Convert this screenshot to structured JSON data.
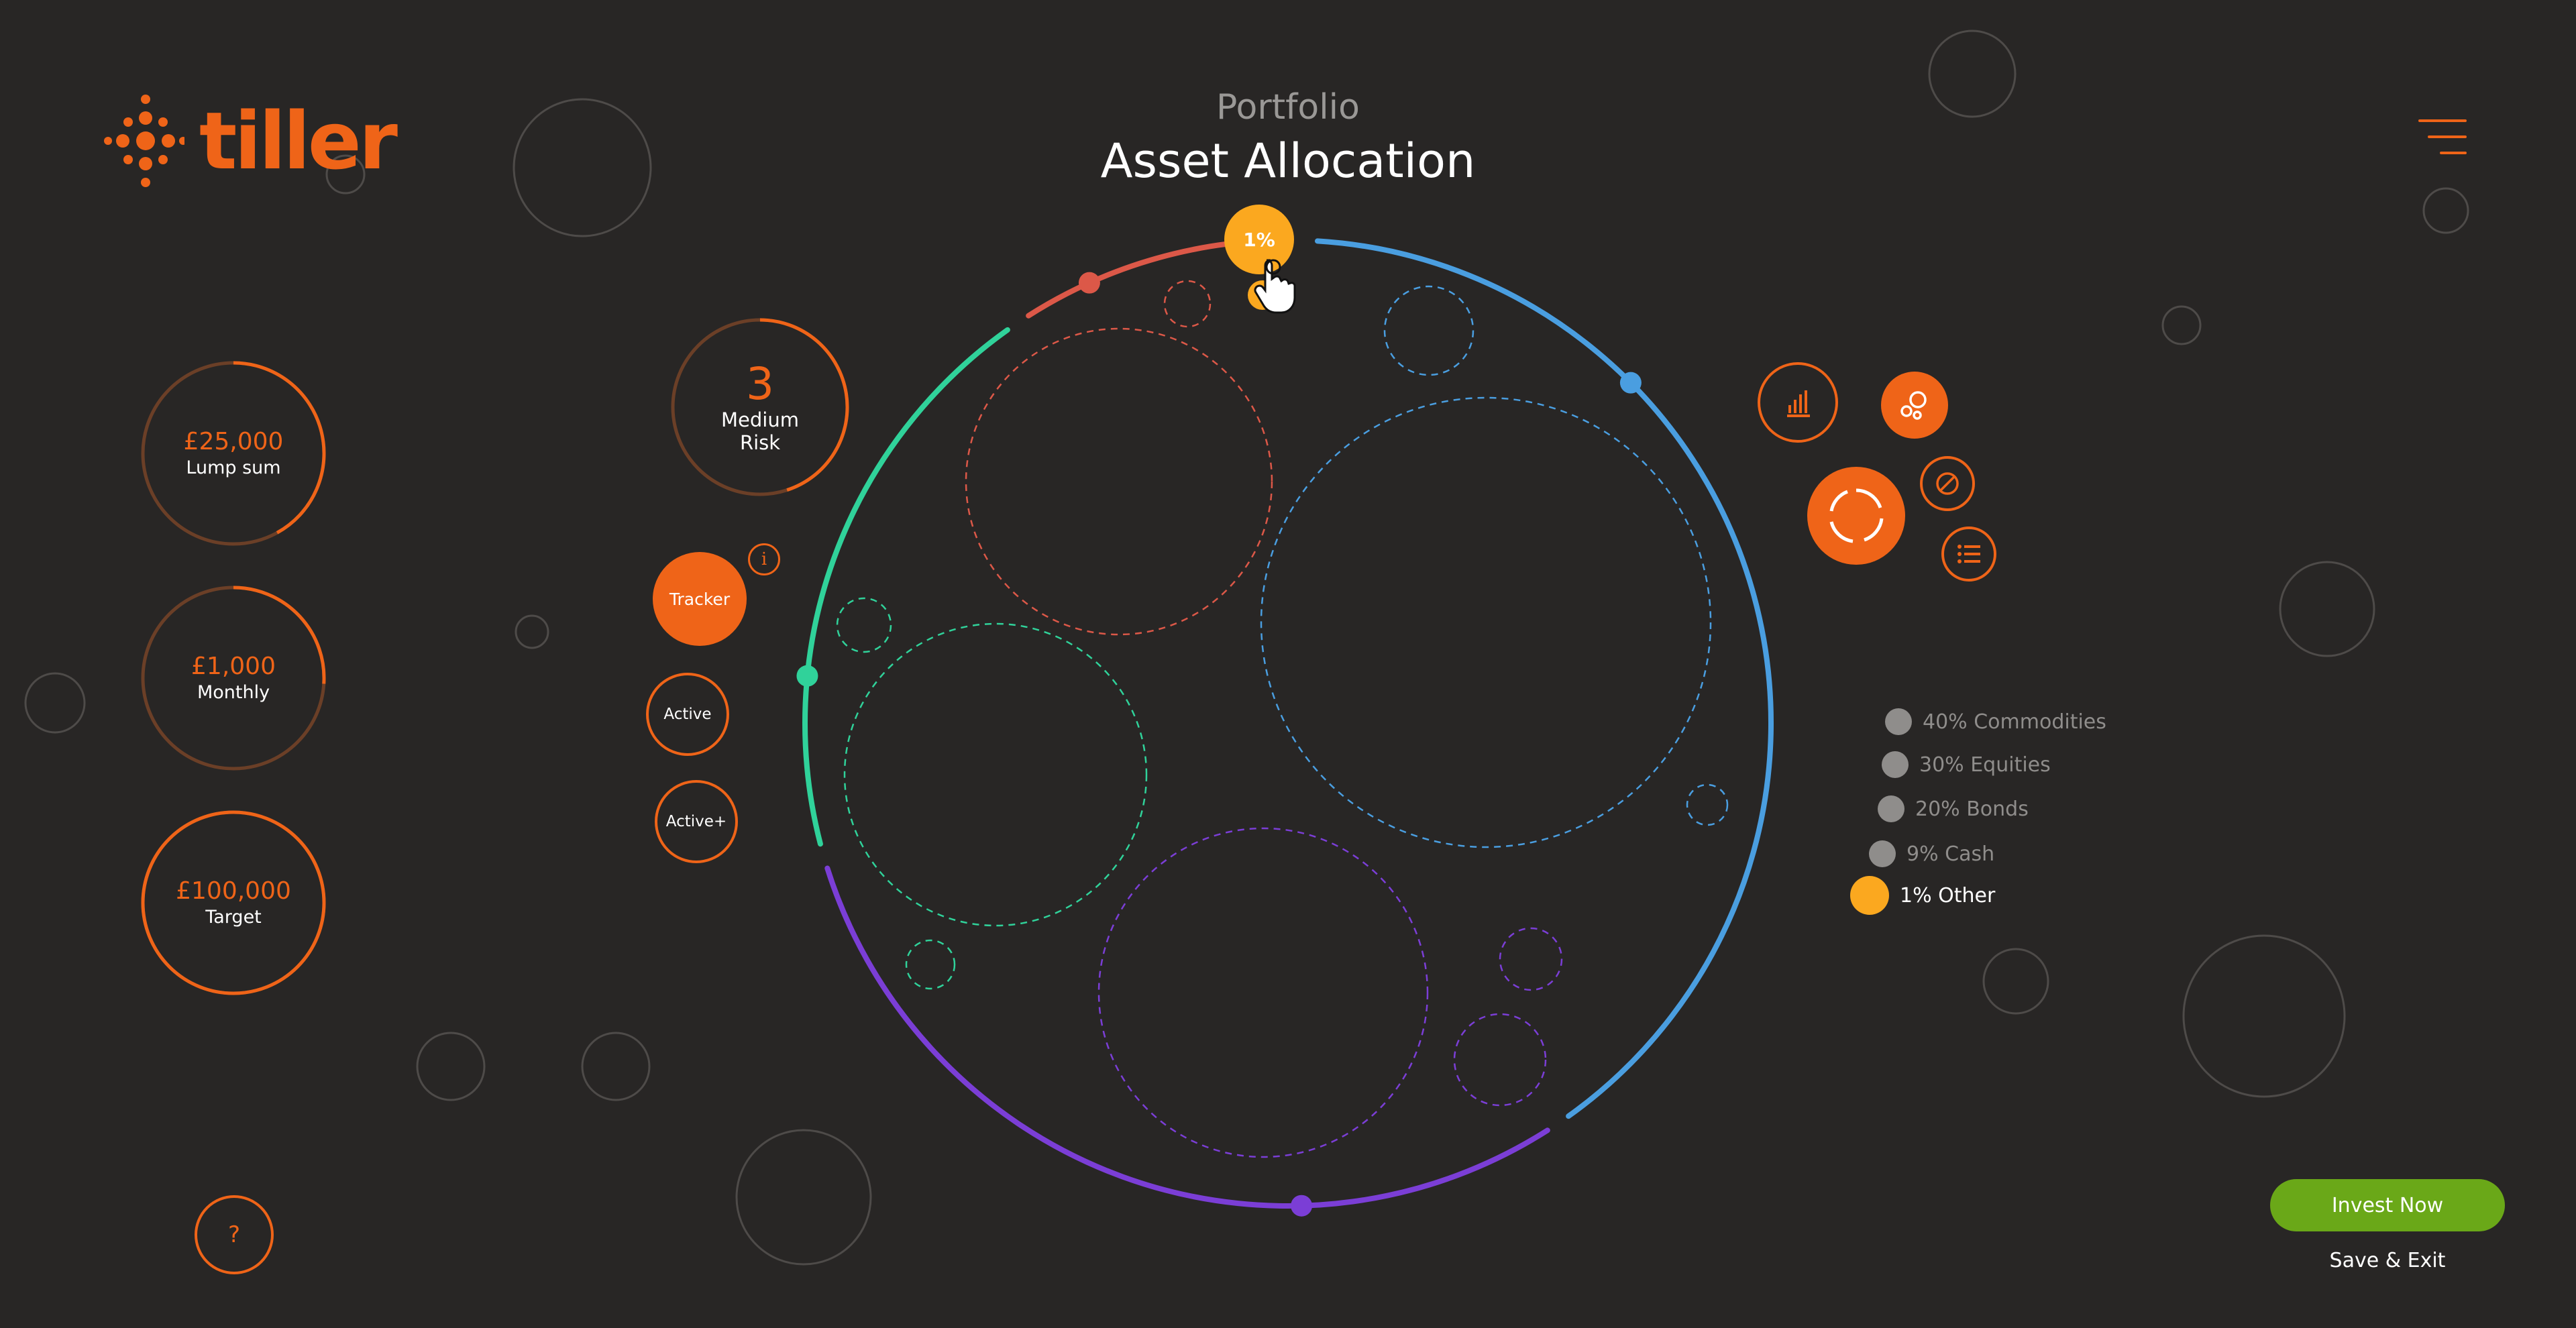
{
  "brand": {
    "name": "tiller",
    "color": "#ef6418"
  },
  "header": {
    "subtitle": "Portfolio",
    "title": "Asset Allocation"
  },
  "menu": {
    "icon": "menu-icon"
  },
  "inputs": [
    {
      "value": "£25,000",
      "label": "Lump sum",
      "progress": 0.42
    },
    {
      "value": "£1,000",
      "label": "Monthly",
      "progress": 0.26
    },
    {
      "value": "£100,000",
      "label": "Target",
      "progress": 1.0
    }
  ],
  "risk": {
    "level": "3",
    "label": "Medium Risk",
    "progress": 0.45
  },
  "strategies": {
    "tracker": "Tracker",
    "active": "Active",
    "active_plus": "Active+",
    "selected": "Tracker"
  },
  "info": {
    "label": "i"
  },
  "allocation": {
    "selected_label": "1%",
    "segments": [
      {
        "name": "Commodities",
        "percent": 40,
        "color": "#4a9ee0"
      },
      {
        "name": "Equities",
        "percent": 30,
        "color": "#7b3ed6"
      },
      {
        "name": "Bonds",
        "percent": 20,
        "color": "#30d29a"
      },
      {
        "name": "Cash",
        "percent": 9,
        "color": "#dc5848"
      },
      {
        "name": "Other",
        "percent": 1,
        "color": "#fba81f"
      }
    ]
  },
  "legend": [
    {
      "text": "40% Commodities",
      "active": false
    },
    {
      "text": "30% Equities",
      "active": false
    },
    {
      "text": "20% Bonds",
      "active": false
    },
    {
      "text": "9% Cash",
      "active": false
    },
    {
      "text": "1% Other",
      "active": true
    }
  ],
  "tools": [
    {
      "name": "bar-chart-icon",
      "style": "outline"
    },
    {
      "name": "bubbles-icon",
      "style": "filled"
    },
    {
      "name": "donut-icon",
      "style": "filled"
    },
    {
      "name": "compass-icon",
      "style": "outline"
    },
    {
      "name": "list-icon",
      "style": "outline"
    }
  ],
  "actions": {
    "invest": "Invest Now",
    "save_exit": "Save & Exit"
  },
  "help": {
    "label": "?"
  }
}
